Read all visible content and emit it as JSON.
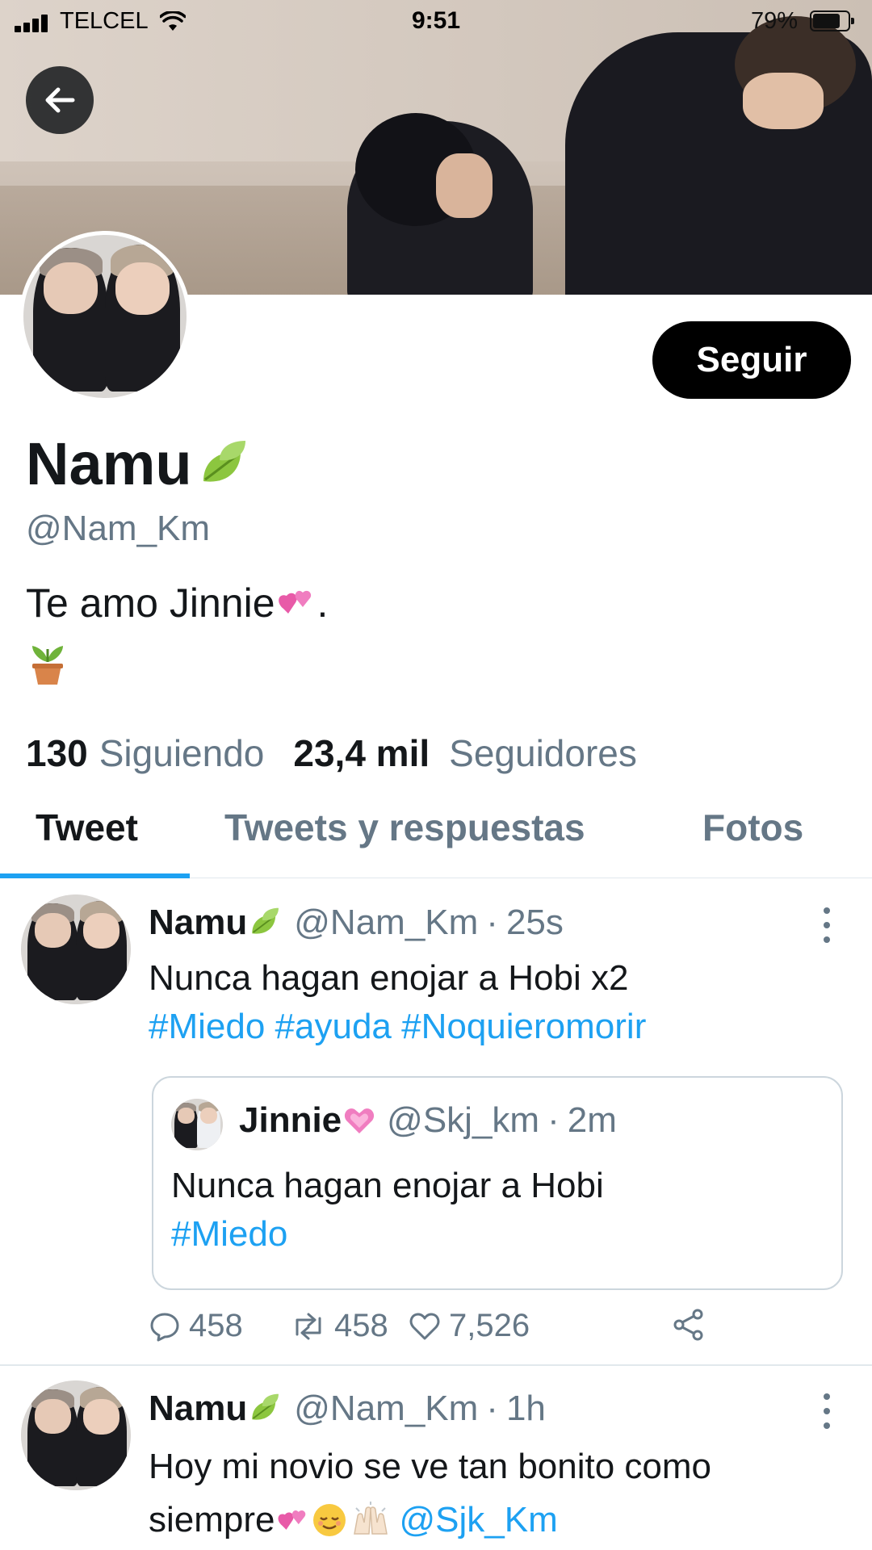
{
  "status_bar": {
    "carrier": "TELCEL",
    "time": "9:51",
    "battery_percent": "79%",
    "battery_level": 0.79
  },
  "profile": {
    "name": "Namu",
    "name_emoji": "leaf-icon",
    "handle": "@Nam_Km",
    "bio": "Te amo Jinnie",
    "bio_end": ".",
    "bio_emoji_icon": "potted-plant-icon",
    "follow_label": "Seguir",
    "following_count": "130",
    "following_label": "Siguiendo",
    "followers_count": "23,4 mil",
    "followers_label": "Seguidores"
  },
  "tabs": [
    {
      "label": "Tweet",
      "active": true
    },
    {
      "label": "Tweets y respuestas",
      "active": false
    },
    {
      "label": "Fotos",
      "active": false
    }
  ],
  "tweets": [
    {
      "name": "Namu",
      "handle": "@Nam_Km",
      "time": "25s",
      "text": "Nunca hagan enojar a Hobi x2",
      "hashtags": "#Miedo #ayuda #Noquieromorir",
      "quote": {
        "name": "Jinnie",
        "handle": "@Skj_km",
        "time": "2m",
        "text": "Nunca hagan enojar a Hobi",
        "hashtag": "#Miedo"
      },
      "replies": "458",
      "retweets": "458",
      "likes": "7,526"
    },
    {
      "name": "Namu",
      "handle": "@Nam_Km",
      "time": "1h",
      "text_line1": "Hoy mi novio se ve tan bonito como",
      "text_line2": "siempre",
      "mention": "@Sjk_Km"
    }
  ],
  "colors": {
    "accent": "#1da1f2",
    "muted": "#657786",
    "text": "#14171a",
    "border": "#e1e8ed"
  }
}
